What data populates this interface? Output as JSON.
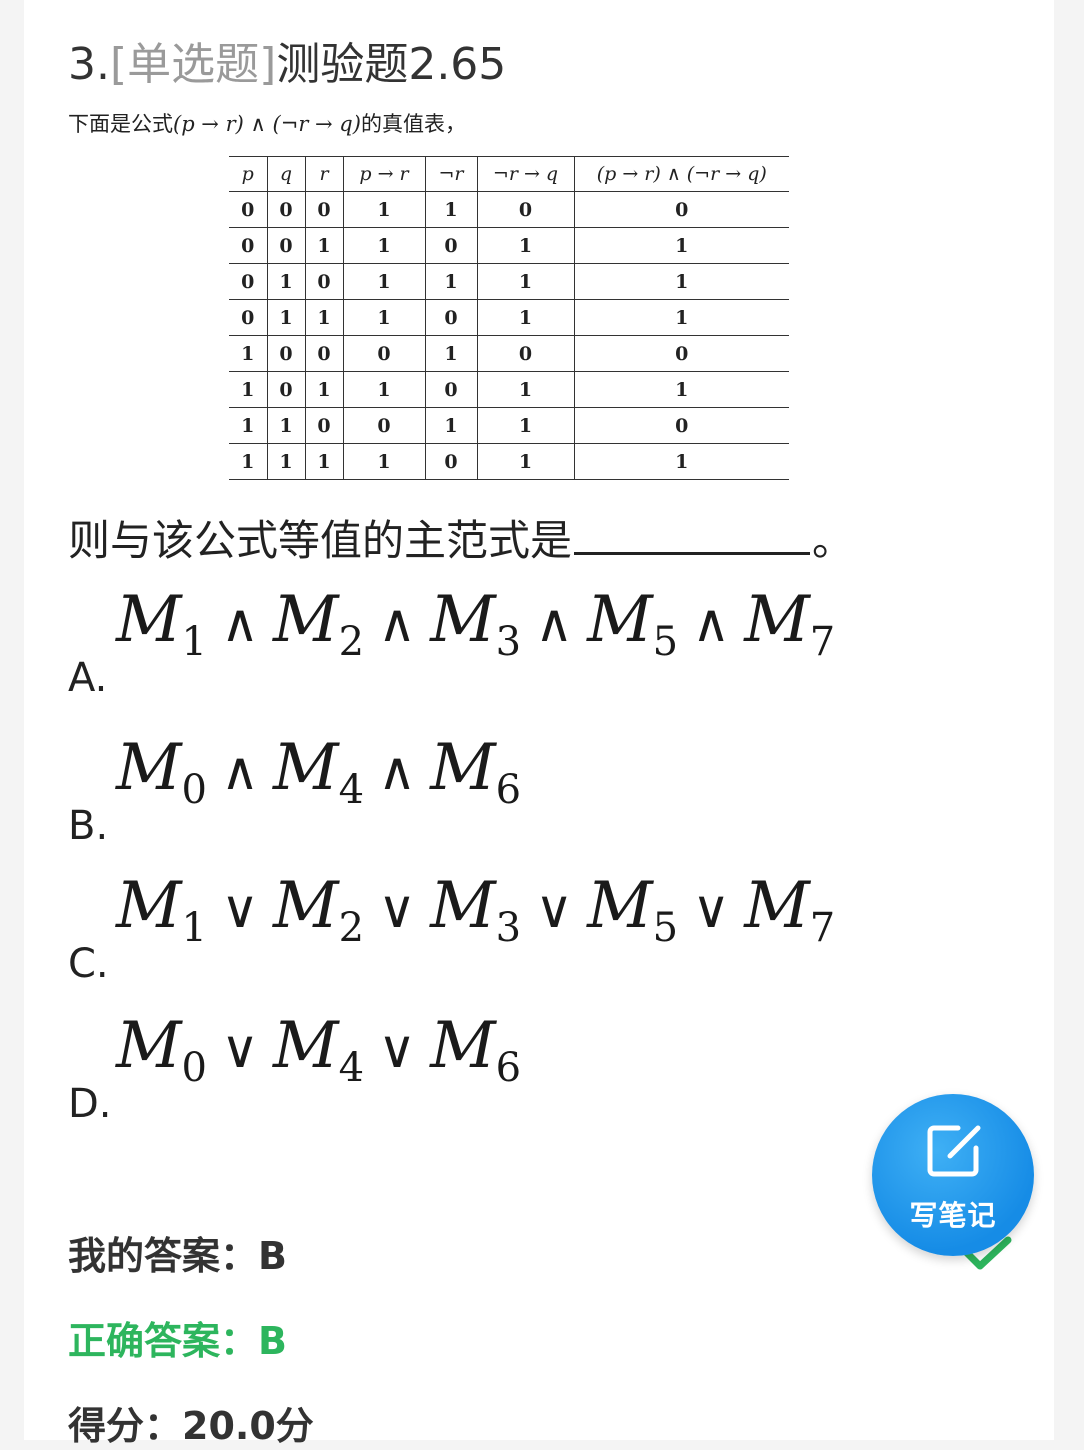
{
  "question": {
    "number": "3.",
    "type": "[单选题]",
    "title": "测验题2.65",
    "intro_prefix": "下面是公式",
    "intro_formula": "(p → r) ∧ (¬r → q)",
    "intro_suffix": "的真值表，"
  },
  "truth_table": {
    "headers": [
      "p",
      "q",
      "r",
      "p → r",
      "¬r",
      "¬r → q",
      "(p → r) ∧ (¬r → q)"
    ],
    "rows": [
      [
        "0",
        "0",
        "0",
        "1",
        "1",
        "0",
        "0"
      ],
      [
        "0",
        "0",
        "1",
        "1",
        "0",
        "1",
        "1"
      ],
      [
        "0",
        "1",
        "0",
        "1",
        "1",
        "1",
        "1"
      ],
      [
        "0",
        "1",
        "1",
        "1",
        "0",
        "1",
        "1"
      ],
      [
        "1",
        "0",
        "0",
        "0",
        "1",
        "0",
        "0"
      ],
      [
        "1",
        "0",
        "1",
        "1",
        "0",
        "1",
        "1"
      ],
      [
        "1",
        "1",
        "0",
        "0",
        "1",
        "1",
        "0"
      ],
      [
        "1",
        "1",
        "1",
        "1",
        "0",
        "1",
        "1"
      ]
    ]
  },
  "prompt": {
    "text": "则与该公式等值的主范式是",
    "end": "。"
  },
  "options": [
    {
      "letter": "A.",
      "op": "∧",
      "indices": [
        "1",
        "2",
        "3",
        "5",
        "7"
      ]
    },
    {
      "letter": "B.",
      "op": "∧",
      "indices": [
        "0",
        "4",
        "6"
      ]
    },
    {
      "letter": "C.",
      "op": "∨",
      "indices": [
        "1",
        "2",
        "3",
        "5",
        "7"
      ]
    },
    {
      "letter": "D.",
      "op": "∨",
      "indices": [
        "0",
        "4",
        "6"
      ]
    }
  ],
  "results": {
    "my_answer_label": "我的答案：",
    "my_answer": "B",
    "correct_label": "正确答案：",
    "correct": "B",
    "score_label": "得分：",
    "score": "20.0分"
  },
  "note_button": {
    "label": "写笔记",
    "icon": "edit-note-icon"
  },
  "check_icon": "check-icon",
  "colors": {
    "correct": "#2db55d",
    "button": "#168ce6",
    "type_tag": "#9a9a9a"
  }
}
